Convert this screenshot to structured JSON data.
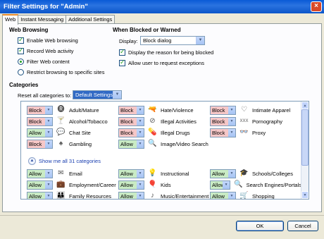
{
  "window": {
    "title": "Filter Settings for \"Admin\"",
    "close_glyph": "×"
  },
  "tabs": [
    {
      "label": "Web",
      "active": true
    },
    {
      "label": "Instant Messaging",
      "active": false
    },
    {
      "label": "Additional Settings",
      "active": false
    }
  ],
  "web_browsing": {
    "title": "Web Browsing",
    "enable_label": "Enable Web browsing",
    "record_label": "Record Web activity",
    "filter_label": "Filter Web content",
    "restrict_label": "Restrict browsing to specific sites"
  },
  "blocked": {
    "title": "When Blocked or Warned",
    "display_label": "Display:",
    "display_value": "Block dialog",
    "reason_label": "Display the reason for being blocked",
    "exceptions_label": "Allow user to request exceptions"
  },
  "categories": {
    "title": "Categories",
    "reset_label": "Reset all categories to:",
    "reset_value": "Default Settings",
    "show_more": "Show me all 31 categories",
    "top": [
      {
        "setting": "Block",
        "label": "Adult/Mature",
        "icon": "adult-icon",
        "glyph": "🅡"
      },
      {
        "setting": "Block",
        "label": "Alcohol/Tobacco",
        "icon": "cocktail-icon",
        "glyph": "🍸"
      },
      {
        "setting": "Allow",
        "label": "Chat Site",
        "icon": "chat-bubble-icon",
        "glyph": "💬"
      },
      {
        "setting": "Block",
        "label": "Gambling",
        "icon": "spade-icon",
        "glyph": "♠"
      },
      {
        "setting": "Block",
        "label": "Hate/Violence",
        "icon": "gun-icon",
        "glyph": "🔫"
      },
      {
        "setting": "Block",
        "label": "Illegal Activities",
        "icon": "no-sign-icon",
        "glyph": "⊘"
      },
      {
        "setting": "Block",
        "label": "Illegal Drugs",
        "icon": "pills-icon",
        "glyph": "💊"
      },
      {
        "setting": "Allow",
        "label": "Image/Video Search",
        "icon": "magnifier-icon",
        "glyph": "🔍"
      },
      {
        "setting": "Block",
        "label": "Intimate Apparel",
        "icon": "bra-icon",
        "glyph": "♡"
      },
      {
        "setting": "Block",
        "label": "Pornography",
        "icon": "xxx-icon",
        "glyph": "XXX"
      },
      {
        "setting": "Block",
        "label": "Proxy",
        "icon": "mask-icon",
        "glyph": "👓"
      }
    ],
    "bottom": [
      {
        "setting": "Allow",
        "label": "Email",
        "icon": "envelope-icon",
        "glyph": "✉"
      },
      {
        "setting": "Allow",
        "label": "Employment/Career",
        "icon": "briefcase-icon",
        "glyph": "💼"
      },
      {
        "setting": "Allow",
        "label": "Family Resources",
        "icon": "family-icon",
        "glyph": "👪"
      },
      {
        "setting": "Allow",
        "label": "Instructional",
        "icon": "lightbulb-icon",
        "glyph": "💡"
      },
      {
        "setting": "Allow",
        "label": "Kids",
        "icon": "balloon-icon",
        "glyph": "🎈"
      },
      {
        "setting": "Allow",
        "label": "Music/Entertainment",
        "icon": "music-note-icon",
        "glyph": "♪"
      },
      {
        "setting": "Allow",
        "label": "Schools/Colleges",
        "icon": "graduation-cap-icon",
        "glyph": "🎓"
      },
      {
        "setting": "Allow",
        "label": "Search Engines/Portals",
        "icon": "search-engine-icon",
        "glyph": "🔍"
      },
      {
        "setting": "Allow",
        "label": "Shopping",
        "icon": "cart-icon",
        "glyph": "🛒"
      }
    ]
  },
  "buttons": {
    "ok": "OK",
    "cancel": "Cancel"
  }
}
